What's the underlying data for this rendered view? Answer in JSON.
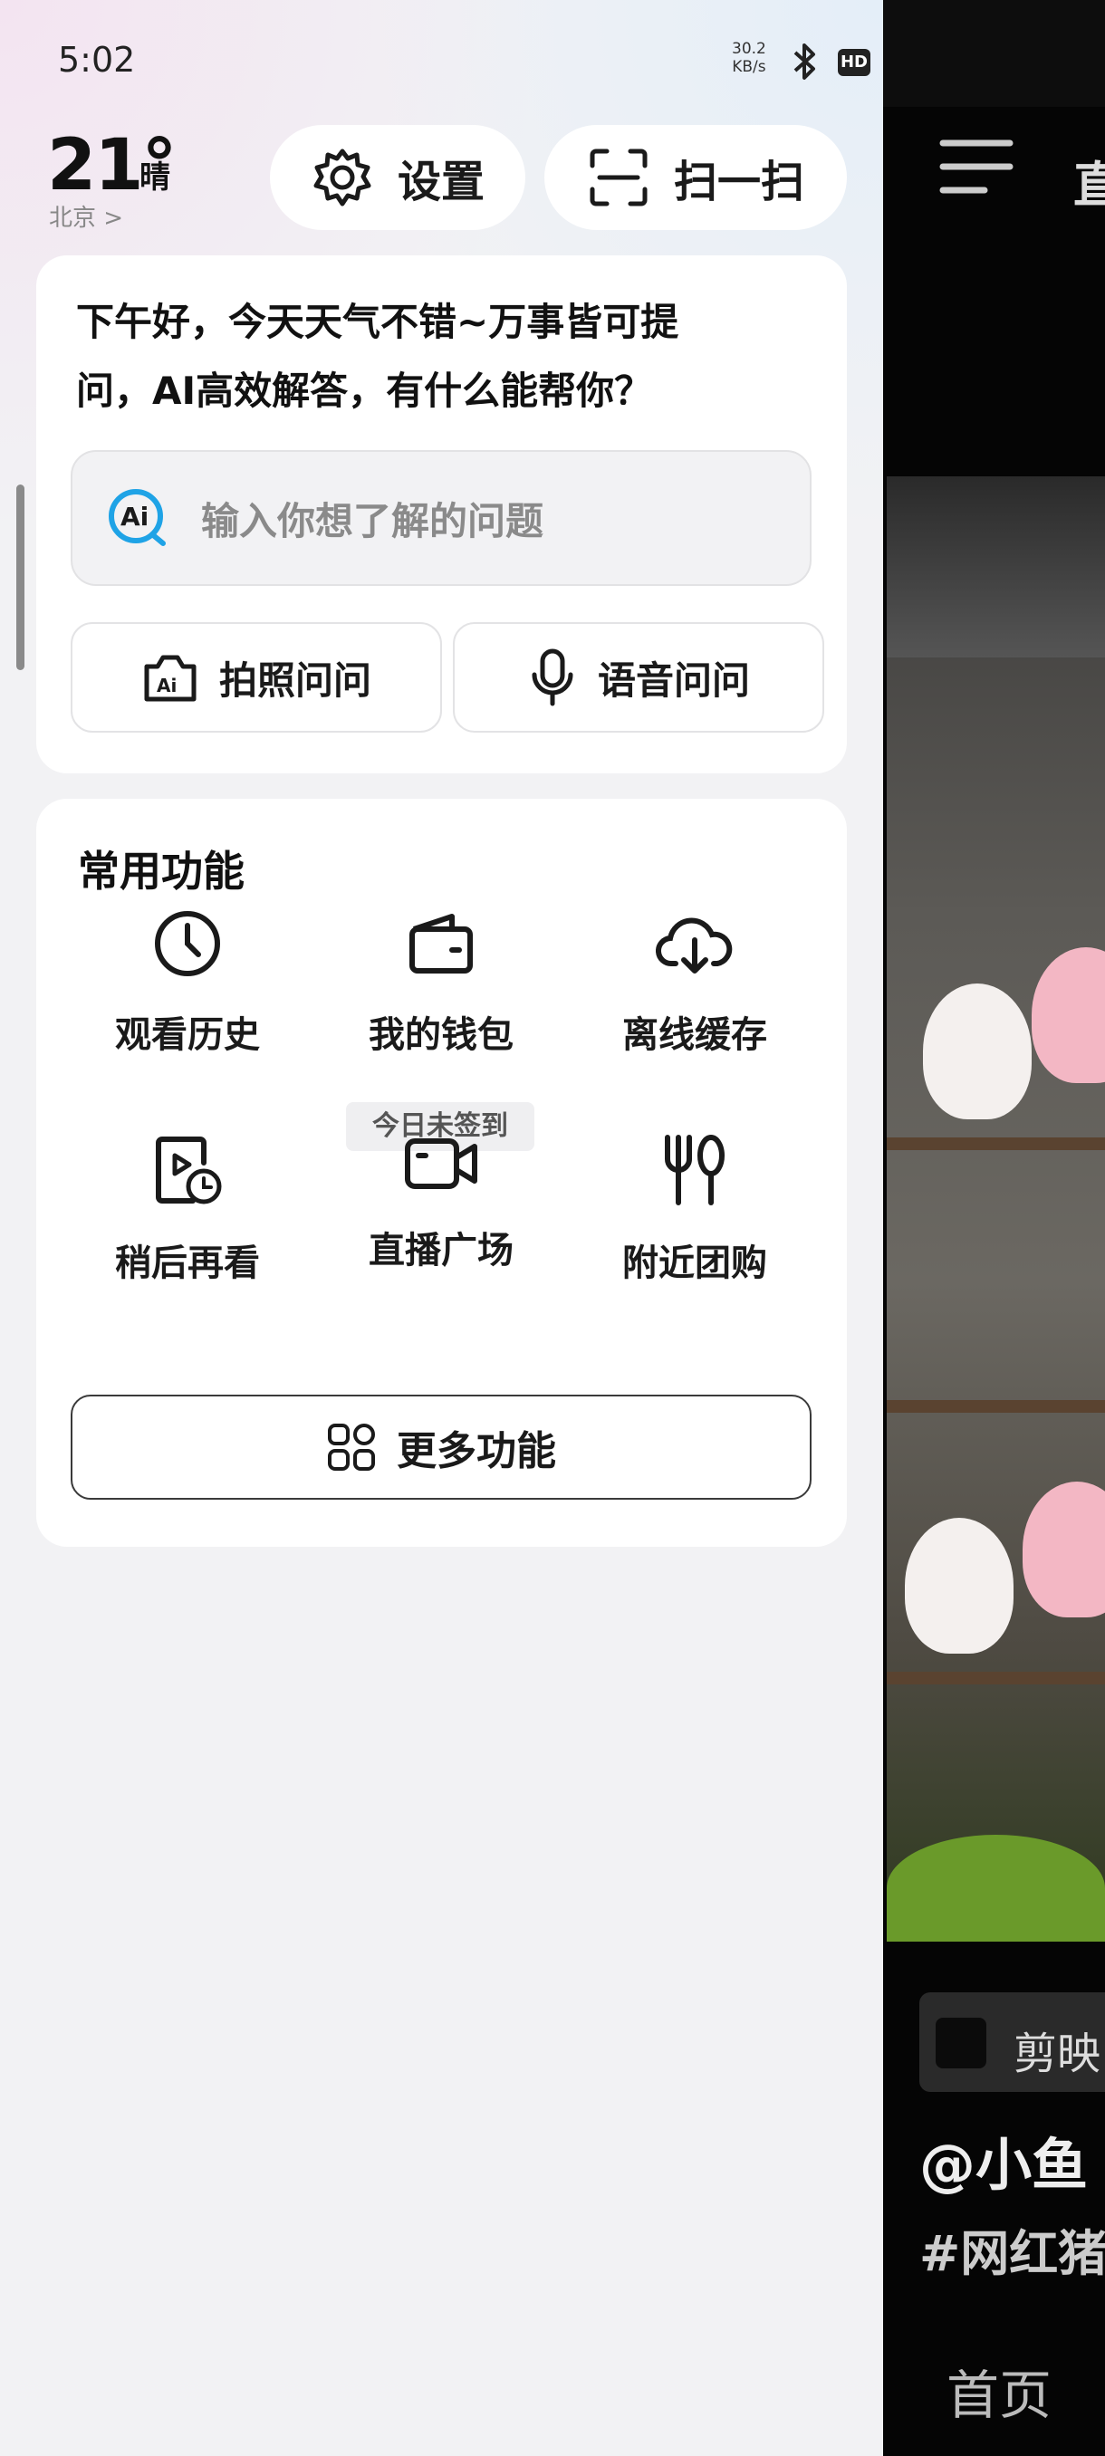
{
  "status_bar": {
    "time": "5:02",
    "speed_value": "30.2",
    "speed_unit": "KB/s",
    "hd_label": "HD"
  },
  "weather": {
    "temperature": "21°",
    "condition": "晴",
    "city": "北京 >"
  },
  "header_buttons": {
    "settings_label": "设置",
    "scan_label": "扫一扫"
  },
  "ai_card": {
    "greeting_line1": "下午好，今天天气不错~万事皆可提",
    "greeting_line2": "问，AI高效解答，有什么能帮你？",
    "search_placeholder": "输入你想了解的问题",
    "photo_ask_label": "拍照问问",
    "voice_ask_label": "语音问问"
  },
  "functions": {
    "title": "常用功能",
    "items": [
      {
        "label": "观看历史",
        "icon": "clock-icon"
      },
      {
        "label": "我的钱包",
        "icon": "wallet-icon",
        "badge": "今日未签到"
      },
      {
        "label": "离线缓存",
        "icon": "cloud-download-icon"
      },
      {
        "label": "稍后再看",
        "icon": "watch-later-icon"
      },
      {
        "label": "直播广场",
        "icon": "camera-icon"
      },
      {
        "label": "附近团购",
        "icon": "fork-knife-icon"
      }
    ],
    "more_label": "更多功能"
  },
  "feed": {
    "tab_partial": "直",
    "capcut_partial": "剪映",
    "author_partial": "@小鱼",
    "tags_partial": "#网红猪",
    "home_label": "首页"
  },
  "colors": {
    "drawer_bg": "#f2f2f4",
    "card_bg": "#ffffff",
    "ai_blue": "#1fa3e6",
    "text": "#1a1a1a"
  }
}
